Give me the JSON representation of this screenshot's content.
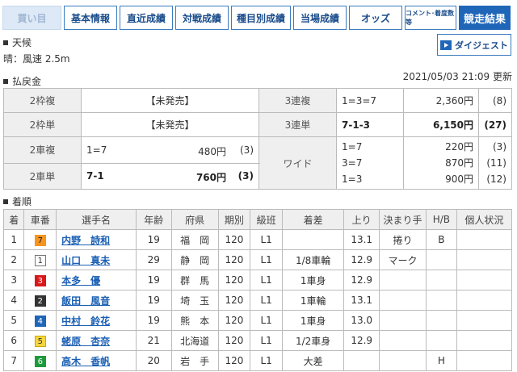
{
  "tabs": [
    {
      "label": "買い目",
      "width": 73,
      "cls": "buy"
    },
    {
      "label": "基本情報",
      "width": 66,
      "cls": ""
    },
    {
      "label": "直近成績",
      "width": 66,
      "cls": ""
    },
    {
      "label": "対戦成績",
      "width": 66,
      "cls": ""
    },
    {
      "label": "種目別成績",
      "width": 74,
      "cls": ""
    },
    {
      "label": "当場成績",
      "width": 66,
      "cls": ""
    },
    {
      "label": "オッズ",
      "width": 66,
      "cls": ""
    },
    {
      "label": "コメント･着度数等",
      "width": 64,
      "cls": "small"
    },
    {
      "label": "競走結果",
      "width": 64,
      "cls": "active"
    }
  ],
  "weather": {
    "heading": "天候",
    "text": "晴：風速 2.5m"
  },
  "digest_label": "ダイジェスト",
  "payout": {
    "heading": "払戻金",
    "updated": "2021/05/03 21:09 更新",
    "waku_fuku": {
      "label": "2枠複",
      "value": "【未発売】"
    },
    "waku_tan": {
      "label": "2枠単",
      "value": "【未発売】"
    },
    "sanrenpuku": {
      "label": "3連複",
      "combo": "1=3=7",
      "amount": "2,360円",
      "pop": "(8)"
    },
    "sanrentan": {
      "label": "3連単",
      "combo": "7-1-3",
      "amount": "6,150円",
      "pop": "(27)"
    },
    "nisha_fuku": {
      "label": "2車複",
      "combo": "1=7",
      "amount": "480円",
      "pop": "(3)"
    },
    "nisha_tan": {
      "label": "2車単",
      "combo": "7-1",
      "amount": "760円",
      "pop": "(3)"
    },
    "wide": {
      "label": "ワイド",
      "rows": [
        {
          "combo": "1=7",
          "amount": "220円",
          "pop": "(3)"
        },
        {
          "combo": "3=7",
          "amount": "870円",
          "pop": "(11)"
        },
        {
          "combo": "1=3",
          "amount": "900円",
          "pop": "(12)"
        }
      ]
    }
  },
  "results": {
    "heading": "着順",
    "columns": [
      "着",
      "車番",
      "選手名",
      "年齢",
      "府県",
      "期別",
      "級班",
      "着差",
      "上り",
      "決まり手",
      "H/B",
      "個人状況"
    ],
    "rows": [
      {
        "rank": "1",
        "car": "7",
        "name": "内野　詩和",
        "age": "19",
        "pref": "福　岡",
        "term": "120",
        "cls": "L1",
        "margin": "",
        "agari": "13.1",
        "kimarite": "捲り",
        "hb": "B",
        "status": "",
        "wbg": "#f7941d",
        "wfg": "#222",
        "wbd": "#f7941d"
      },
      {
        "rank": "2",
        "car": "1",
        "name": "山口　真未",
        "age": "29",
        "pref": "静　岡",
        "term": "120",
        "cls": "L1",
        "margin": "1/8車輪",
        "agari": "12.9",
        "kimarite": "マーク",
        "hb": "",
        "status": "",
        "wbg": "#fff",
        "wfg": "#333",
        "wbd": "#777"
      },
      {
        "rank": "3",
        "car": "3",
        "name": "本多　優",
        "age": "19",
        "pref": "群　馬",
        "term": "120",
        "cls": "L1",
        "margin": "1車身",
        "agari": "12.9",
        "kimarite": "",
        "hb": "",
        "status": "",
        "wbg": "#d7191c",
        "wfg": "#fff",
        "wbd": "#d7191c"
      },
      {
        "rank": "4",
        "car": "2",
        "name": "飯田　風音",
        "age": "19",
        "pref": "埼　玉",
        "term": "120",
        "cls": "L1",
        "margin": "1車輪",
        "agari": "13.1",
        "kimarite": "",
        "hb": "",
        "status": "",
        "wbg": "#333",
        "wfg": "#fff",
        "wbd": "#333"
      },
      {
        "rank": "5",
        "car": "4",
        "name": "中村　鈴花",
        "age": "19",
        "pref": "熊　本",
        "term": "120",
        "cls": "L1",
        "margin": "1車身",
        "agari": "13.0",
        "kimarite": "",
        "hb": "",
        "status": "",
        "wbg": "#1f66b8",
        "wfg": "#fff",
        "wbd": "#1f66b8"
      },
      {
        "rank": "6",
        "car": "5",
        "name": "蛯原　杏奈",
        "age": "21",
        "pref": "北海道",
        "term": "120",
        "cls": "L1",
        "margin": "1/2車身",
        "agari": "12.9",
        "kimarite": "",
        "hb": "",
        "status": "",
        "wbg": "#f5d63d",
        "wfg": "#333",
        "wbd": "#c9a800"
      },
      {
        "rank": "7",
        "car": "6",
        "name": "高木　香帆",
        "age": "20",
        "pref": "岩　手",
        "term": "120",
        "cls": "L1",
        "margin": "大差",
        "agari": "",
        "kimarite": "",
        "hb": "H",
        "status": "",
        "wbg": "#1e9a3c",
        "wfg": "#fff",
        "wbd": "#1e9a3c"
      }
    ]
  }
}
